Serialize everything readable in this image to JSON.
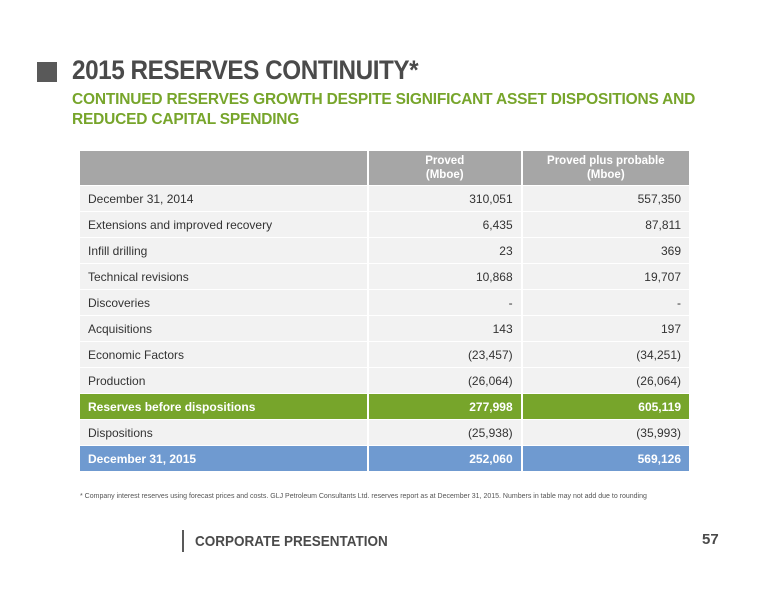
{
  "header": {
    "title": "2015 RESERVES CONTINUITY*",
    "subtitle": "CONTINUED RESERVES GROWTH DESPITE SIGNIFICANT ASSET DISPOSITIONS AND REDUCED CAPITAL SPENDING"
  },
  "table": {
    "columns": [
      "",
      "Proved (Mboe)",
      "Proved plus probable (Mboe)"
    ],
    "col1_line1": "Proved",
    "col1_line2": "(Mboe)",
    "col2_line1": "Proved plus probable",
    "col2_line2": "(Mboe)",
    "rows": [
      {
        "label": "December 31, 2014",
        "proved": "310,051",
        "probable": "557,350"
      },
      {
        "label": "Extensions and improved recovery",
        "proved": "6,435",
        "probable": "87,811"
      },
      {
        "label": "Infill drilling",
        "proved": "23",
        "probable": "369"
      },
      {
        "label": "Technical revisions",
        "proved": "10,868",
        "probable": "19,707"
      },
      {
        "label": "Discoveries",
        "proved": "-",
        "probable": "-"
      },
      {
        "label": "Acquisitions",
        "proved": "143",
        "probable": "197"
      },
      {
        "label": "Economic Factors",
        "proved": "(23,457)",
        "probable": "(34,251)"
      },
      {
        "label": "Production",
        "proved": "(26,064)",
        "probable": "(26,064)"
      },
      {
        "label": "Reserves before dispositions",
        "proved": "277,998",
        "probable": "605,119"
      },
      {
        "label": "Dispositions",
        "proved": "(25,938)",
        "probable": "(35,993)"
      },
      {
        "label": "December 31, 2015",
        "proved": "252,060",
        "probable": "569,126"
      }
    ]
  },
  "footnote": "* Company interest reserves using forecast prices and costs. GLJ Petroleum Consultants Ltd. reserves report as at December 31, 2015. Numbers in table may not add due to rounding",
  "footer": {
    "label": "CORPORATE PRESENTATION",
    "page_number": "57"
  },
  "colors": {
    "accent_green": "#77a52b",
    "accent_blue": "#6f9ad0",
    "header_gray": "#a6a6a6"
  }
}
